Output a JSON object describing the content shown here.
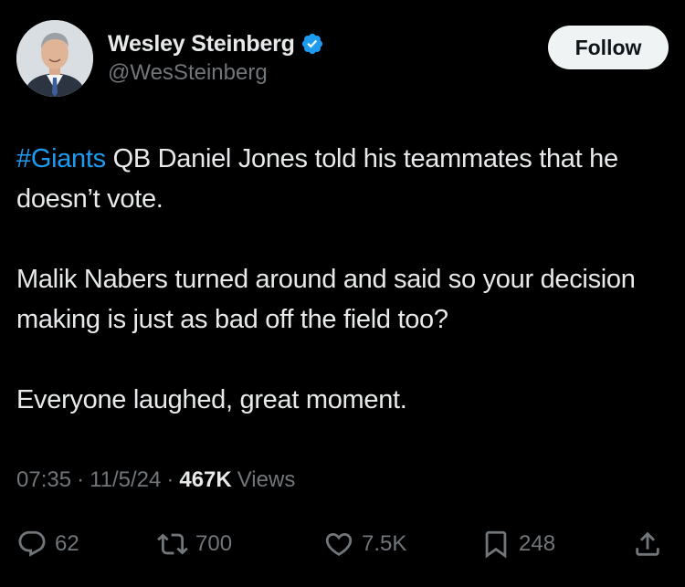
{
  "author": {
    "display_name": "Wesley Steinberg",
    "handle": "@WesSteinberg",
    "verified": true,
    "verified_color": "#1d9bf0"
  },
  "follow_button": {
    "label": "Follow"
  },
  "tweet": {
    "paragraphs": [
      {
        "hashtag": "#Giants",
        "text": " QB Daniel Jones told his teammates that he doesn’t vote."
      },
      {
        "text": "Malik Nabers turned around and said so your decision making is just as bad off the field too?"
      },
      {
        "text": "Everyone laughed, great moment."
      }
    ]
  },
  "meta": {
    "time": "07:35",
    "separator": "·",
    "date": "11/5/24",
    "views_count": "467K",
    "views_label": "Views"
  },
  "actions": {
    "reply": {
      "icon": "reply-icon",
      "count": "62"
    },
    "retweet": {
      "icon": "retweet-icon",
      "count": "700"
    },
    "like": {
      "icon": "heart-icon",
      "count": "7.5K"
    },
    "bookmark": {
      "icon": "bookmark-icon",
      "count": "248"
    },
    "share": {
      "icon": "share-icon"
    }
  },
  "colors": {
    "background": "#000000",
    "text_primary": "#e7e9ea",
    "text_secondary": "#71767b",
    "link": "#1d9bf0",
    "follow_bg": "#eff3f4"
  }
}
